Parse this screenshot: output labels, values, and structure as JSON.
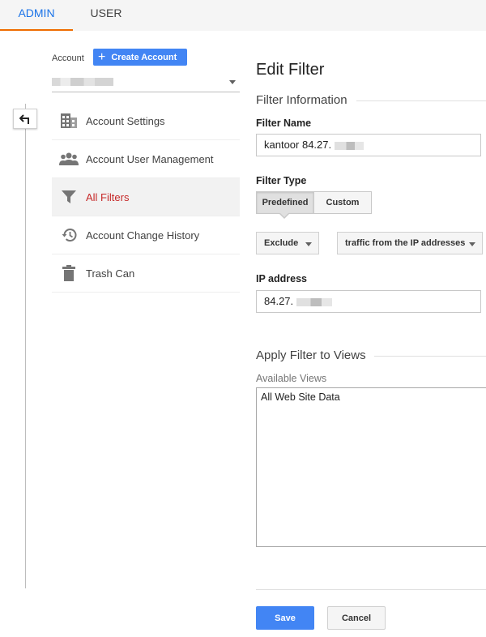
{
  "tabs": [
    {
      "label": "ADMIN",
      "active": true
    },
    {
      "label": "USER",
      "active": false
    }
  ],
  "account": {
    "label": "Account",
    "create_button": "Create Account"
  },
  "nav": {
    "items": [
      {
        "label": "Account Settings",
        "icon": "building-icon"
      },
      {
        "label": "Account User Management",
        "icon": "people-icon"
      },
      {
        "label": "All Filters",
        "icon": "filter-icon",
        "active": true
      },
      {
        "label": "Account Change History",
        "icon": "history-icon"
      },
      {
        "label": "Trash Can",
        "icon": "trash-icon"
      }
    ]
  },
  "form": {
    "title": "Edit Filter",
    "info_section": "Filter Information",
    "filter_name_label": "Filter Name",
    "filter_name_value": "kantoor 84.27.",
    "filter_type_label": "Filter Type",
    "type_options": [
      "Predefined",
      "Custom"
    ],
    "type_selected": "Predefined",
    "action_value": "Exclude",
    "source_value": "traffic from the IP addresses",
    "ip_label": "IP address",
    "ip_value": "84.27.",
    "apply_section": "Apply Filter to Views",
    "available_views_label": "Available Views",
    "available_views": [
      "All Web Site Data"
    ],
    "save_label": "Save",
    "cancel_label": "Cancel"
  },
  "colors": {
    "accent_blue": "#4285f4",
    "active_tab_text": "#1a73e8",
    "active_tab_underline": "#ef6c00",
    "active_nav_text": "#c62828"
  }
}
